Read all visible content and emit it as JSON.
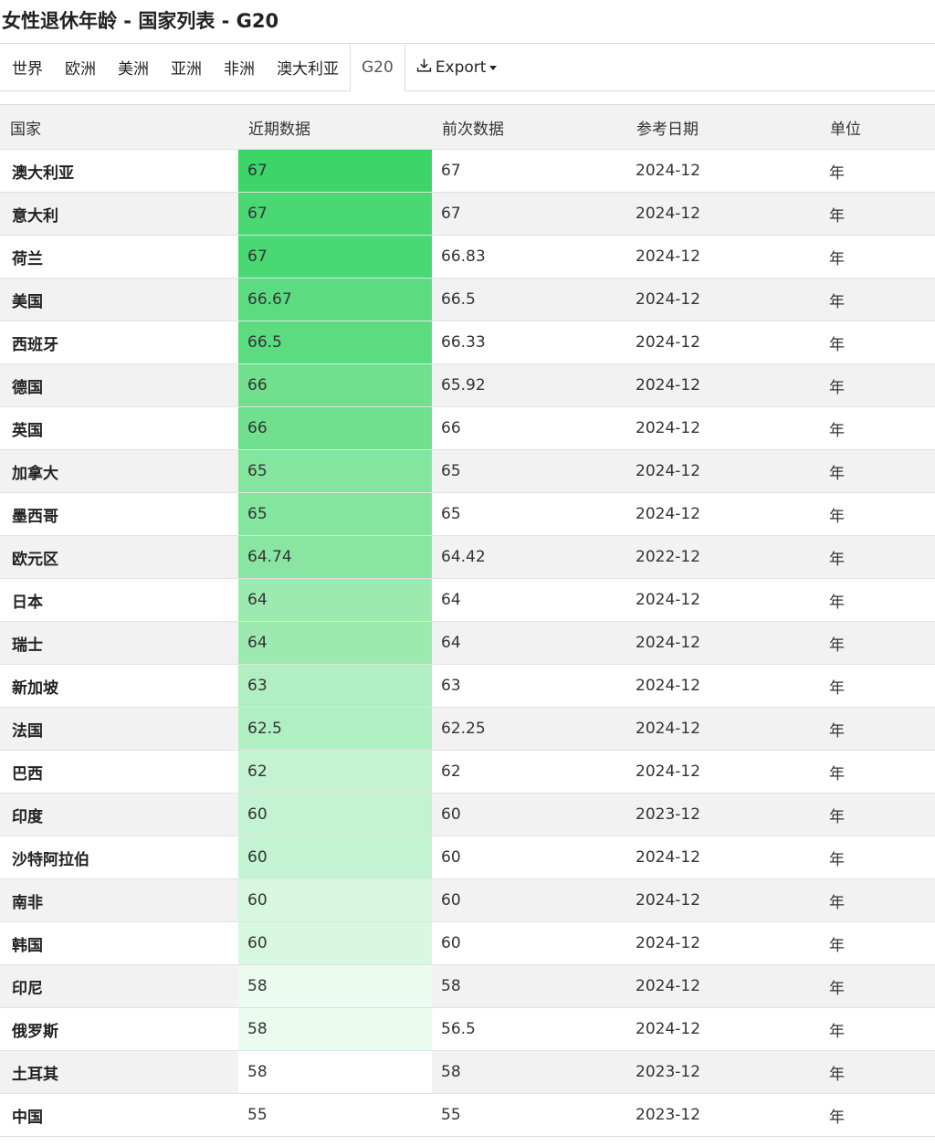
{
  "title": "女性退休年龄 - 国家列表 - G20",
  "tabs": [
    {
      "label": "世界"
    },
    {
      "label": "欧洲"
    },
    {
      "label": "美洲"
    },
    {
      "label": "亚洲"
    },
    {
      "label": "非洲"
    },
    {
      "label": "澳大利亚"
    },
    {
      "label": "G20",
      "active": true
    }
  ],
  "export_label": "Export",
  "table": {
    "headers": [
      "国家",
      "近期数据",
      "前次数据",
      "参考日期",
      "单位"
    ],
    "rows": [
      {
        "country": "澳大利亚",
        "latest": "67",
        "previous": "67",
        "date": "2024-12",
        "unit": "年",
        "heat": "#3dd468"
      },
      {
        "country": "意大利",
        "latest": "67",
        "previous": "67",
        "date": "2024-12",
        "unit": "年",
        "heat": "#4ad872"
      },
      {
        "country": "荷兰",
        "latest": "67",
        "previous": "66.83",
        "date": "2024-12",
        "unit": "年",
        "heat": "#4ad872"
      },
      {
        "country": "美国",
        "latest": "66.67",
        "previous": "66.5",
        "date": "2024-12",
        "unit": "年",
        "heat": "#5cdc80"
      },
      {
        "country": "西班牙",
        "latest": "66.5",
        "previous": "66.33",
        "date": "2024-12",
        "unit": "年",
        "heat": "#5cdc80"
      },
      {
        "country": "德国",
        "latest": "66",
        "previous": "65.92",
        "date": "2024-12",
        "unit": "年",
        "heat": "#70e08f"
      },
      {
        "country": "英国",
        "latest": "66",
        "previous": "66",
        "date": "2024-12",
        "unit": "年",
        "heat": "#70e08f"
      },
      {
        "country": "加拿大",
        "latest": "65",
        "previous": "65",
        "date": "2024-12",
        "unit": "年",
        "heat": "#84e59e"
      },
      {
        "country": "墨西哥",
        "latest": "65",
        "previous": "65",
        "date": "2024-12",
        "unit": "年",
        "heat": "#84e59e"
      },
      {
        "country": "欧元区",
        "latest": "64.74",
        "previous": "64.42",
        "date": "2022-12",
        "unit": "年",
        "heat": "#89e6a2"
      },
      {
        "country": "日本",
        "latest": "64",
        "previous": "64",
        "date": "2024-12",
        "unit": "年",
        "heat": "#9deab1"
      },
      {
        "country": "瑞士",
        "latest": "64",
        "previous": "64",
        "date": "2024-12",
        "unit": "年",
        "heat": "#9deab1"
      },
      {
        "country": "新加坡",
        "latest": "63",
        "previous": "63",
        "date": "2024-12",
        "unit": "年",
        "heat": "#b0efc1"
      },
      {
        "country": "法国",
        "latest": "62.5",
        "previous": "62.25",
        "date": "2024-12",
        "unit": "年",
        "heat": "#b0efc1"
      },
      {
        "country": "巴西",
        "latest": "62",
        "previous": "62",
        "date": "2024-12",
        "unit": "年",
        "heat": "#c3f3d0"
      },
      {
        "country": "印度",
        "latest": "60",
        "previous": "60",
        "date": "2023-12",
        "unit": "年",
        "heat": "#c3f3d0"
      },
      {
        "country": "沙特阿拉伯",
        "latest": "60",
        "previous": "60",
        "date": "2024-12",
        "unit": "年",
        "heat": "#c3f3d0"
      },
      {
        "country": "南非",
        "latest": "60",
        "previous": "60",
        "date": "2024-12",
        "unit": "年",
        "heat": "#d8f7e1"
      },
      {
        "country": "韩国",
        "latest": "60",
        "previous": "60",
        "date": "2024-12",
        "unit": "年",
        "heat": "#d8f7e1"
      },
      {
        "country": "印尼",
        "latest": "58",
        "previous": "58",
        "date": "2024-12",
        "unit": "年",
        "heat": "#ebfbf0"
      },
      {
        "country": "俄罗斯",
        "latest": "58",
        "previous": "56.5",
        "date": "2024-12",
        "unit": "年",
        "heat": "#ebfbf0"
      },
      {
        "country": "土耳其",
        "latest": "58",
        "previous": "58",
        "date": "2023-12",
        "unit": "年",
        "heat": "#ffffff"
      },
      {
        "country": "中国",
        "latest": "55",
        "previous": "55",
        "date": "2023-12",
        "unit": "年",
        "heat": "#ffffff"
      }
    ]
  }
}
